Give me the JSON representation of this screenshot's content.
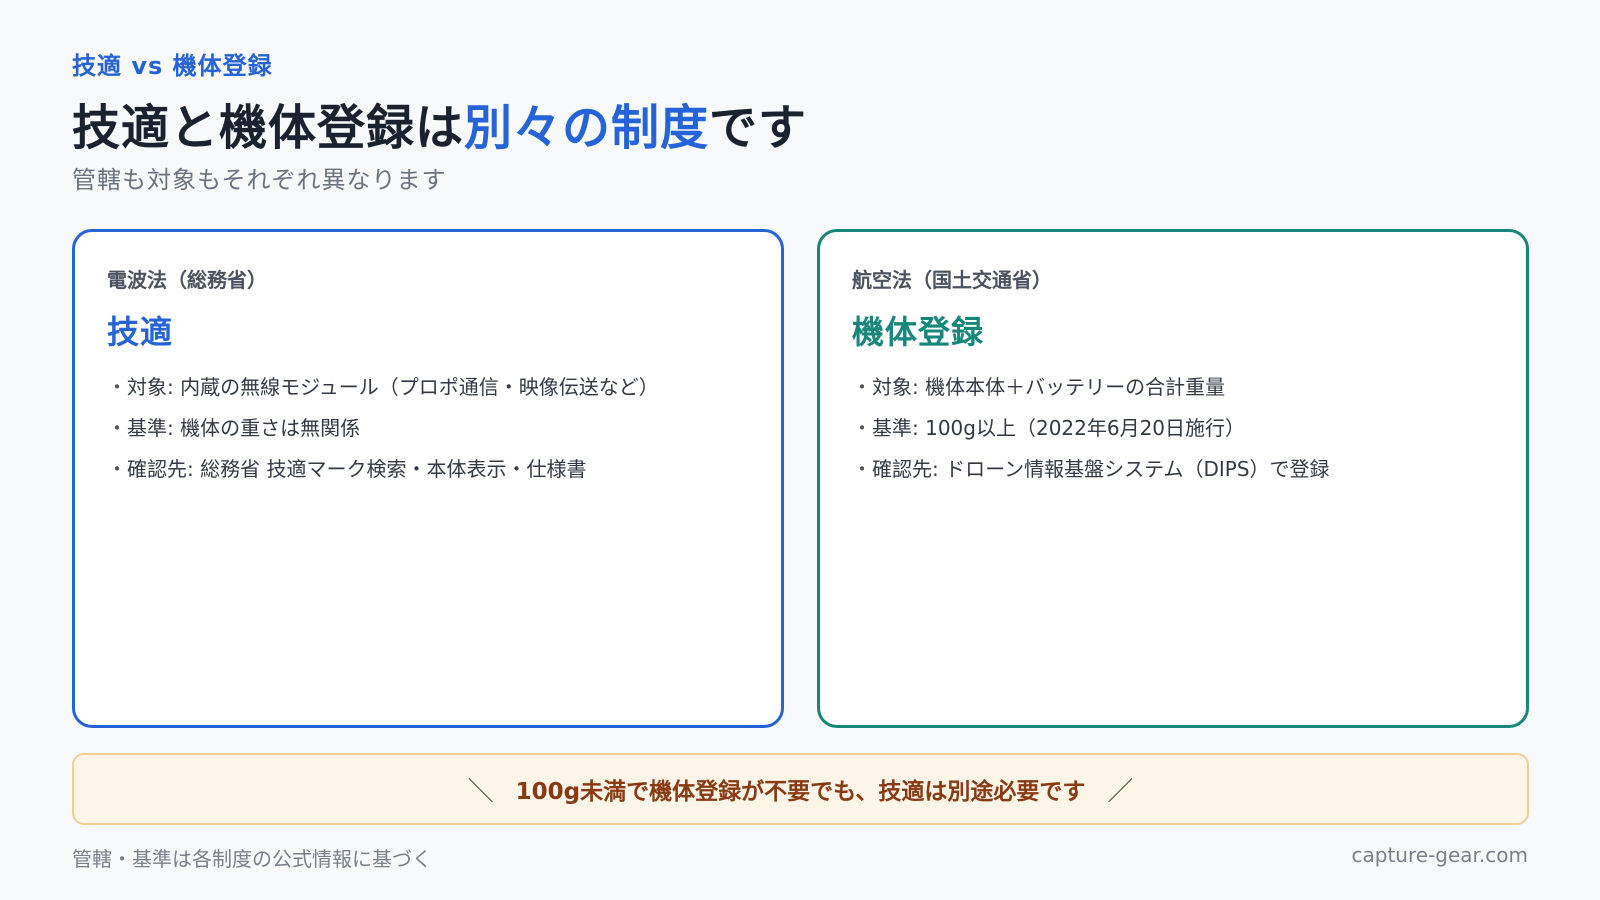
{
  "header": {
    "eyebrow": "技適 vs 機体登録",
    "title_part1": "技適と機体登録は",
    "title_accent": "別々の制度",
    "title_part2": "です",
    "subtitle": "管轄も対象もそれぞれ異なります"
  },
  "cards": [
    {
      "law": "電波法（総務省）",
      "name": "技適",
      "items": [
        "対象: 内蔵の無線モジュール（プロポ通信・映像伝送など）",
        "基準: 機体の重さは無関係",
        "確認先: 総務省 技適マーク検索・本体表示・仕様書"
      ]
    },
    {
      "law": "航空法（国土交通省）",
      "name": "機体登録",
      "items": [
        "対象: 機体本体＋バッテリーの合計重量",
        "基準: 100g以上（2022年6月20日施行）",
        "確認先: ドローン情報基盤システム（DIPS）で登録"
      ]
    }
  ],
  "banner": {
    "left_mark": "＼",
    "text": "100g未満で機体登録が不要でも、技適は別途必要です",
    "right_mark": "／"
  },
  "footer": {
    "note": "管轄・基準は各制度の公式情報に基づく",
    "site": "capture-gear.com"
  },
  "colors": {
    "accent_blue": "#2563d9",
    "accent_teal": "#17877a",
    "banner_bg": "#fdf5e8",
    "banner_text": "#8a3a12"
  }
}
